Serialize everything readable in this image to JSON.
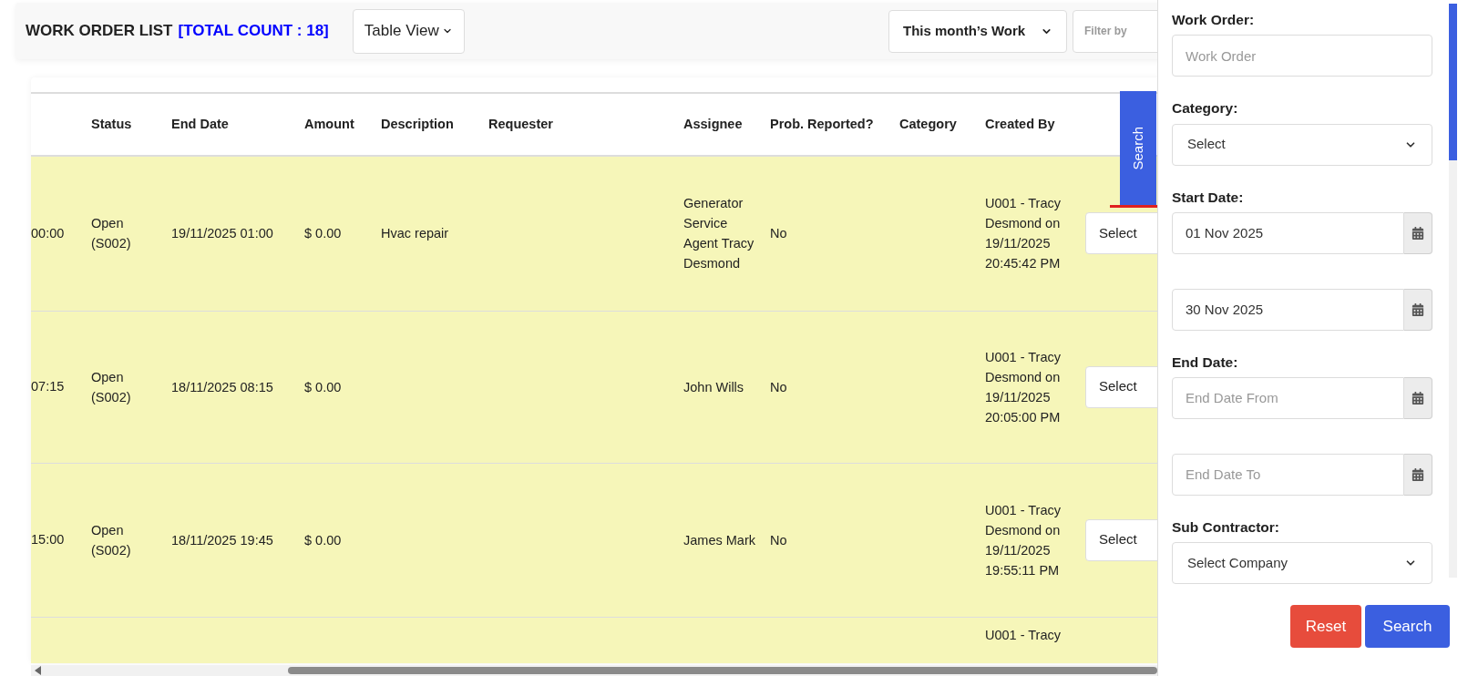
{
  "header": {
    "title": "WORK ORDER LIST",
    "count": "[TOTAL COUNT : 18]",
    "view_select": "Table View",
    "period_select": "This month’s Work",
    "filter_placeholder": "Filter by"
  },
  "table": {
    "columns": [
      "Status",
      "End Date",
      "Amount",
      "Description",
      "Requester",
      "Assignee",
      "Prob. Reported?",
      "Category",
      "Created By"
    ],
    "rows": [
      {
        "column_1": "00:00",
        "status": "Open (S002)",
        "end_date": "19/11/2025 01:00",
        "amount": "$ 0.00",
        "description": "Hvac repair",
        "assignee": "Generator Service Agent Tracy Desmond",
        "prob_reported": "No",
        "created_by": "U001 - Tracy Desmond on 19/11/2025 20:45:42 PM",
        "action": "Select"
      },
      {
        "column_1": "07:15",
        "status": "Open (S002)",
        "end_date": "18/11/2025 08:15",
        "amount": "$ 0.00",
        "assignee": "John Wills",
        "prob_reported": "No",
        "created_by": "U001 - Tracy Desmond on 19/11/2025 20:05:00 PM",
        "action": "Select"
      },
      {
        "column_1": "15:00",
        "status": "Open (S002)",
        "end_date": "18/11/2025 19:45",
        "amount": "$ 0.00",
        "assignee": "James Mark",
        "prob_reported": "No",
        "created_by": "U001 - Tracy Desmond on 19/11/2025 19:55:11 PM",
        "action": "Select"
      },
      {
        "created_by": "U001 - Tracy"
      }
    ]
  },
  "search_tab": "Search",
  "filter_panel": {
    "fields": [
      {
        "kind": "input",
        "label": "Work Order:",
        "placeholder": "Work Order"
      },
      {
        "kind": "select",
        "label": "Category:",
        "value": "Select"
      },
      {
        "kind": "date",
        "label": "Start Date:",
        "value": "01 Nov 2025"
      },
      {
        "kind": "date",
        "value": "30 Nov 2025"
      },
      {
        "kind": "date",
        "label": "End Date:",
        "placeholder": "End Date From"
      },
      {
        "kind": "date",
        "placeholder": "End Date To"
      },
      {
        "kind": "select",
        "label": "Sub Contractor:",
        "value": "Select Company"
      }
    ],
    "buttons": [
      {
        "kind": "reset",
        "label": "Reset"
      },
      {
        "kind": "search",
        "label": "Search"
      }
    ]
  }
}
